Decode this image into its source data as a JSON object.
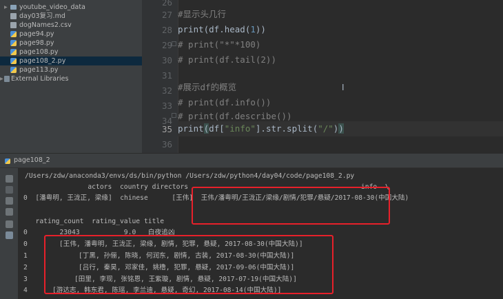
{
  "project_tree": [
    {
      "label": "youtube_video_data",
      "icon": "folder-icon",
      "name": "tree-folder-youtube-video-data"
    },
    {
      "label": "day03复习.md",
      "icon": "markdown-file-icon",
      "name": "tree-file-day03-md"
    },
    {
      "label": "dogNames2.csv",
      "icon": "csv-file-icon",
      "name": "tree-file-dognames2-csv"
    },
    {
      "label": "page94.py",
      "icon": "python-file-icon",
      "name": "tree-file-page94"
    },
    {
      "label": "page98.py",
      "icon": "python-file-icon",
      "name": "tree-file-page98"
    },
    {
      "label": "page108.py",
      "icon": "python-file-icon",
      "name": "tree-file-page108"
    },
    {
      "label": "page108_2.py",
      "icon": "python-file-icon",
      "name": "tree-file-page108-2",
      "selected": true
    },
    {
      "label": "page113.py",
      "icon": "python-file-icon",
      "name": "tree-file-page113"
    },
    {
      "label": "External Libraries",
      "icon": "library-icon",
      "name": "tree-external-libraries"
    }
  ],
  "editor": {
    "line_numbers": [
      "26",
      "27",
      "28",
      "29",
      "30",
      "31",
      "32",
      "33",
      "34",
      "35",
      "36"
    ],
    "current_line": "35",
    "lines": {
      "l27": "#显示头几行",
      "l28a": "print(df.head(",
      "l28n": "1",
      "l28b": "))",
      "l29a": "# print(\"*\"*100)",
      "l30": "# print(df.tail(2))",
      "l32": "#展示df的概览",
      "l33": "# print(df.info())",
      "l34": "# print(df.describe())",
      "l35a": "print",
      "l35p": "(",
      "l35b": "df[",
      "l35s1": "\"info\"",
      "l35c": "].str.split(",
      "l35s2": "\"/\"",
      "l35d": ")",
      "l35e": ")"
    },
    "cursor_symbol": "I"
  },
  "run_tab": {
    "label": "page108_2"
  },
  "console": {
    "command": "/Users/zdw/anaconda3/envs/ds/bin/python /Users/zdw/python4/day04/code/page108_2.py",
    "header1": "                actors  country directors                                           info  \\",
    "row0a": "0  [潘粤明, 王泷正, 梁缘]  chinese      [王伟]  王伟/潘粤明/王泷正/梁缘/剧情/犯罪/悬疑/2017-08-30(中国大陆)",
    "header2": "   rating_count  rating_value title",
    "row0b": "0        23043           9.0   白夜追凶",
    "split_rows": [
      {
        "idx": "0",
        "text": "[王伟, 潘粤明, 王泷正, 梁缘, 剧情, 犯罪, 悬疑, 2017-08-30(中国大陆)]"
      },
      {
        "idx": "1",
        "text": "[丁黑, 孙俪, 陈晓, 何润东, 剧情, 古装, 2017-08-30(中国大陆)]"
      },
      {
        "idx": "2",
        "text": "[吕行, 秦昊, 邓家佳, 姚橹, 犯罪, 悬疑, 2017-09-06(中国大陆)]"
      },
      {
        "idx": "3",
        "text": "[田里, 李现, 张铭恩, 王紫璇, 剧情, 悬疑, 2017-07-19(中国大陆)]"
      },
      {
        "idx": "4",
        "text": "[游达志, 韩东君, 陈瑶, 李兰迪, 悬疑, 奇幻, 2017-08-14(中国大陆)]"
      }
    ],
    "toolbar_icons": [
      "rerun-icon",
      "stop-icon",
      "scroll-down-icon",
      "soft-wrap-icon",
      "print-icon",
      "trash-icon"
    ],
    "highlight_color": "#e8202a"
  }
}
